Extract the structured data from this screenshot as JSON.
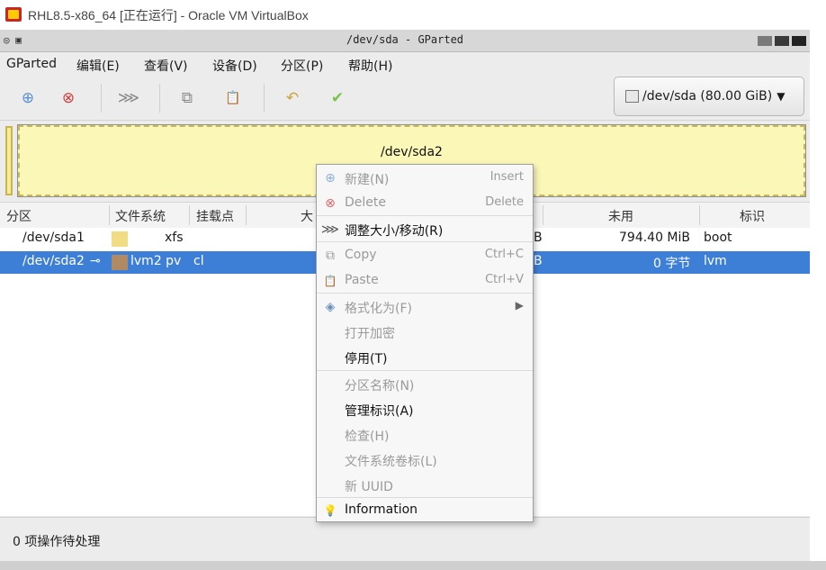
{
  "host": {
    "title": "RHL8.5-x86_64 [正在运行] - Oracle VM VirtualBox"
  },
  "window": {
    "title": "/dev/sda - GParted",
    "corner_icons": "◎ ▣"
  },
  "menubar": {
    "items": [
      "GParted",
      "编辑(E)",
      "查看(V)",
      "设备(D)",
      "分区(P)",
      "帮助(H)"
    ]
  },
  "toolbar": {
    "device_selector": "/dev/sda (80.00 GiB)",
    "buttons": [
      {
        "name": "new",
        "icon": "new-partition-icon",
        "glyph": "⊕"
      },
      {
        "name": "delete",
        "icon": "delete-icon",
        "glyph": "⊗"
      },
      {
        "name": "resize",
        "icon": "resize-move-icon",
        "glyph": "⋙"
      },
      {
        "name": "copy",
        "icon": "copy-icon",
        "glyph": "⧉"
      },
      {
        "name": "paste",
        "icon": "paste-icon",
        "glyph": "📋"
      },
      {
        "name": "undo",
        "icon": "undo-icon",
        "glyph": "↶"
      },
      {
        "name": "apply",
        "icon": "apply-check-icon",
        "glyph": "✔"
      }
    ]
  },
  "disk_map": {
    "partition_label": "/dev/sda2"
  },
  "table": {
    "headers": [
      "分区",
      "文件系统",
      "挂载点",
      "大",
      "未用",
      "标识"
    ],
    "rows": [
      {
        "partition": "/dev/sda1",
        "fs": "xfs",
        "mount": "",
        "size_tail": "B",
        "unused": "794.40 MiB",
        "flags": "boot",
        "color": "#f0dc82"
      },
      {
        "partition": "/dev/sda2",
        "fs": "lvm2 pv",
        "mount": "cl",
        "size_tail": "B",
        "unused": "0 字节",
        "flags": "lvm",
        "color": "#b08a62"
      }
    ]
  },
  "status": {
    "pending": "0 项操作待处理"
  },
  "context_menu": {
    "items": [
      {
        "label": "新建(N)",
        "accel": "Insert",
        "enabled": false,
        "icon": "new-icon",
        "glyph": "⊕"
      },
      {
        "label": "Delete",
        "accel": "Delete",
        "enabled": false,
        "icon": "delete-icon",
        "glyph": "⊗"
      },
      {
        "label": "调整大小/移动(R)",
        "accel": "",
        "enabled": true,
        "icon": "resize-move-icon",
        "glyph": "⋙"
      },
      {
        "label": "Copy",
        "accel": "Ctrl+C",
        "enabled": false,
        "icon": "copy-icon",
        "glyph": "⧉"
      },
      {
        "label": "Paste",
        "accel": "Ctrl+V",
        "enabled": false,
        "icon": "paste-icon",
        "glyph": "📋"
      },
      {
        "label": "格式化为(F)",
        "accel": "",
        "enabled": false,
        "icon": "format-icon",
        "glyph": "◈",
        "submenu": true
      },
      {
        "label": "打开加密",
        "accel": "",
        "enabled": false
      },
      {
        "label": "停用(T)",
        "accel": "",
        "enabled": true
      },
      {
        "label": "分区名称(N)",
        "accel": "",
        "enabled": false
      },
      {
        "label": "管理标识(A)",
        "accel": "",
        "enabled": true
      },
      {
        "label": "检查(H)",
        "accel": "",
        "enabled": false
      },
      {
        "label": "文件系统卷标(L)",
        "accel": "",
        "enabled": false
      },
      {
        "label": "新 UUID",
        "accel": "",
        "enabled": false
      },
      {
        "label": "Information",
        "accel": "",
        "enabled": true,
        "icon": "information-bulb-icon",
        "glyph": "💡"
      }
    ]
  },
  "colors": {
    "selection": "#3d7fd6",
    "partition_fill": "#fbf7b7"
  }
}
